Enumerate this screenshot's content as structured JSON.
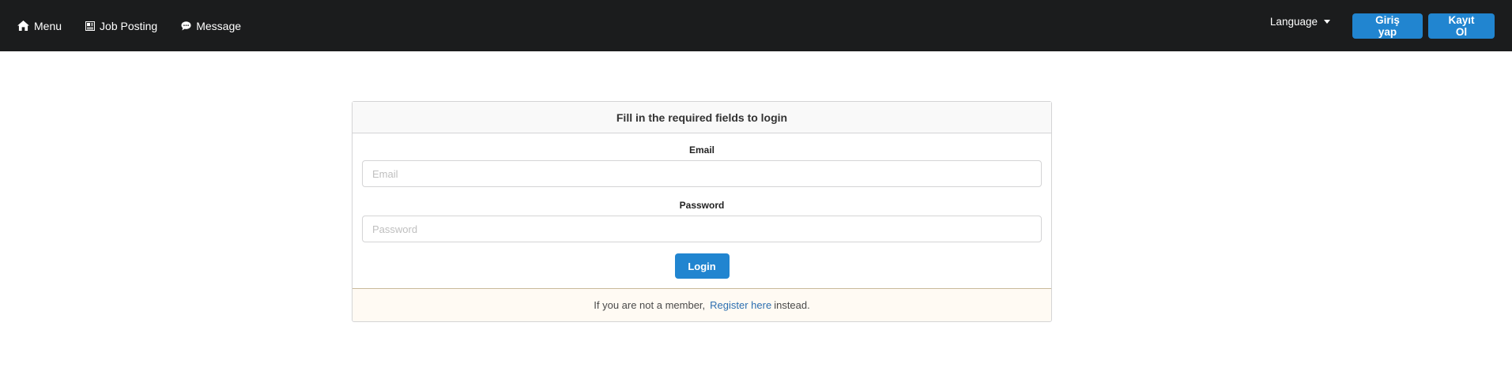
{
  "nav": {
    "items": [
      {
        "label": "Menu",
        "icon": "home-icon"
      },
      {
        "label": "Job Posting",
        "icon": "newspaper-icon"
      },
      {
        "label": "Message",
        "icon": "comment-icon"
      }
    ],
    "language_label": "Language",
    "login_label": "Giriş yap",
    "register_label": "Kayıt Ol"
  },
  "login_form": {
    "header": "Fill in the required fields to login",
    "email_label": "Email",
    "email_placeholder": "Email",
    "email_value": "",
    "password_label": "Password",
    "password_placeholder": "Password",
    "password_value": "",
    "submit_label": "Login"
  },
  "footer_message": {
    "text_before": "If you are not a member,",
    "link_text": "Register here",
    "text_after": "instead."
  },
  "colors": {
    "topbar": "#1b1c1d",
    "accent": "#2185d0",
    "footer_bg": "#fffaf3",
    "link": "#2c6fb0"
  }
}
